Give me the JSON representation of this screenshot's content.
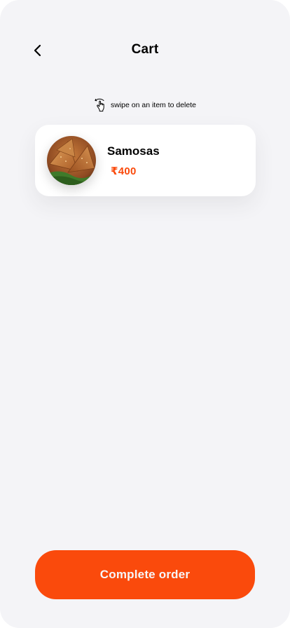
{
  "header": {
    "title": "Cart",
    "back_icon": "chevron-left-icon"
  },
  "hint": {
    "icon": "swipe-hand-icon",
    "text": "swipe on an item to delete"
  },
  "cart": {
    "items": [
      {
        "name": "Samosas",
        "price": "₹400",
        "image": "samosa-food-image"
      }
    ]
  },
  "footer": {
    "button_label": "Complete order"
  },
  "colors": {
    "background": "#f4f4f7",
    "accent": "#fa4a0c",
    "card": "#ffffff",
    "text": "#000000",
    "button_text": "#f6f6f9"
  }
}
